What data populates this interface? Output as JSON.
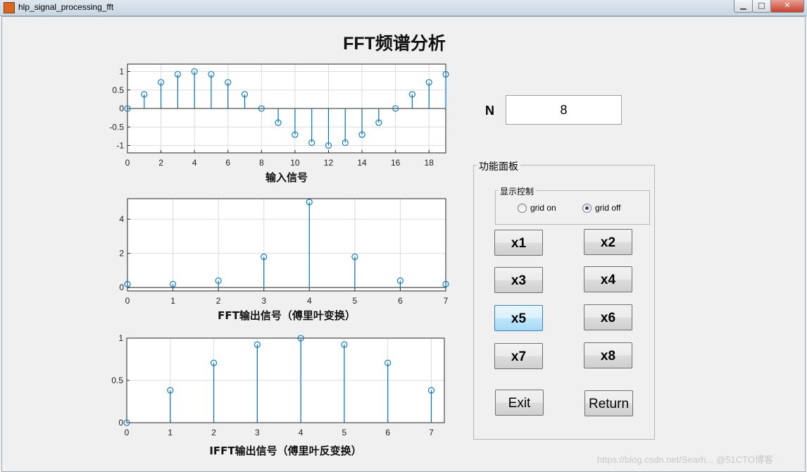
{
  "window": {
    "title": "hlp_signal_processing_fft",
    "minimize": "▁",
    "maximize": "□",
    "close": "✕"
  },
  "page_title": "FFT频谱分析",
  "n_field": {
    "label": "N",
    "value": "8"
  },
  "panel": {
    "title": "功能面板"
  },
  "display_control": {
    "title": "显示控制",
    "options": [
      {
        "label": "grid on",
        "selected": false
      },
      {
        "label": "grid off",
        "selected": true
      }
    ]
  },
  "buttons": {
    "x1": "x1",
    "x2": "x2",
    "x3": "x3",
    "x4": "x4",
    "x5": "x5",
    "x6": "x6",
    "x7": "x7",
    "x8": "x8",
    "exit": "Exit",
    "return": "Return"
  },
  "active_button": "x5",
  "watermark": "https://blog.csdn.net/Searh... @51CTO博客",
  "colors": {
    "stem": "#0072bd",
    "axes": "#262626",
    "grid": "#dcdcdc"
  },
  "chart_data": [
    {
      "type": "stem",
      "xlabel": "输入信号",
      "xlim": [
        0,
        19
      ],
      "ylim": [
        -1.2,
        1.2
      ],
      "xticks": [
        0,
        2,
        4,
        6,
        8,
        10,
        12,
        14,
        16,
        18
      ],
      "yticks": [
        -1,
        -0.5,
        0,
        0.5,
        1
      ],
      "x": [
        0,
        1,
        2,
        3,
        4,
        5,
        6,
        7,
        8,
        9,
        10,
        11,
        12,
        13,
        14,
        15,
        16,
        17,
        18,
        19
      ],
      "values": [
        0,
        0.383,
        0.707,
        0.924,
        1,
        0.924,
        0.707,
        0.383,
        0,
        -0.383,
        -0.707,
        -0.924,
        -1,
        -0.924,
        -0.707,
        -0.383,
        0,
        0.383,
        0.707,
        0.924
      ],
      "grid": true
    },
    {
      "type": "stem",
      "xlabel": "FFT输出信号（傅里叶变换）",
      "xlim": [
        0,
        7
      ],
      "ylim": [
        -0.2,
        5.2
      ],
      "xticks": [
        0,
        1,
        2,
        3,
        4,
        5,
        6,
        7
      ],
      "yticks": [
        0,
        2,
        4
      ],
      "x": [
        0,
        1,
        2,
        3,
        4,
        5,
        6,
        7
      ],
      "values": [
        0.2,
        0.2,
        0.4,
        1.8,
        5.0,
        1.8,
        0.4,
        0.2
      ],
      "grid": true
    },
    {
      "type": "stem",
      "xlabel": "IFFT输出信号（傅里叶反变换）",
      "xlim": [
        0,
        7.3
      ],
      "ylim": [
        0,
        1
      ],
      "xticks": [
        0,
        1,
        2,
        3,
        4,
        5,
        6,
        7
      ],
      "yticks": [
        0,
        0.5,
        1
      ],
      "x": [
        0,
        1,
        2,
        3,
        4,
        5,
        6,
        7
      ],
      "values": [
        0,
        0.383,
        0.707,
        0.924,
        1,
        0.924,
        0.707,
        0.383
      ],
      "grid": true
    }
  ]
}
